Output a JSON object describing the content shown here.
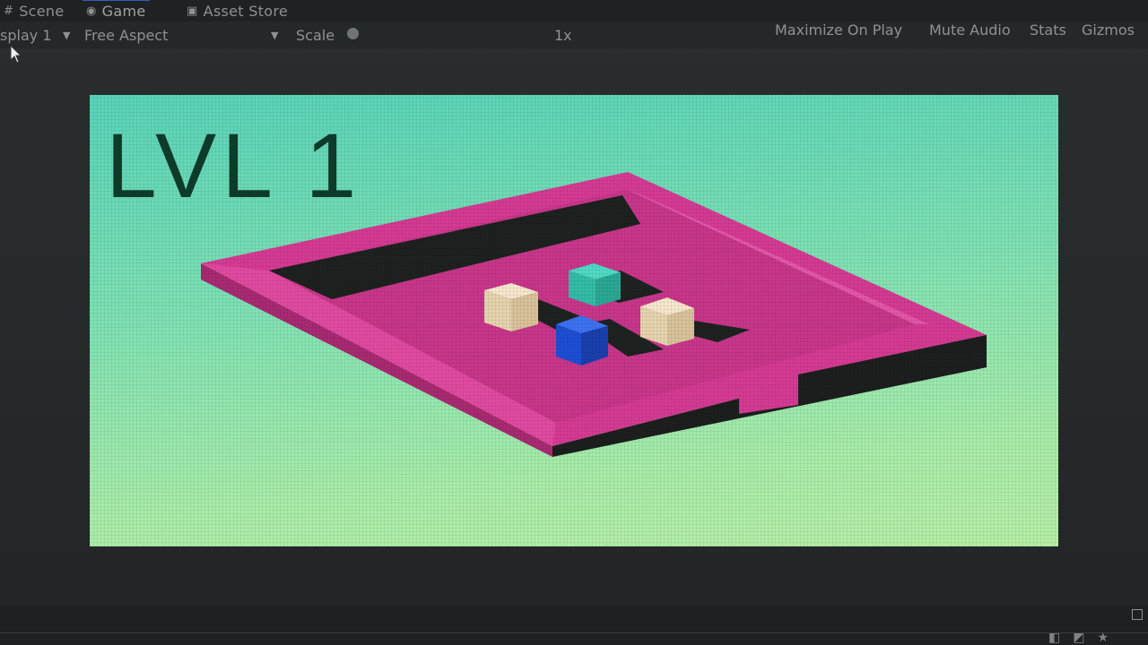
{
  "tabs": {
    "scene": "Scene",
    "game": "Game",
    "asset_store": "Asset Store"
  },
  "toolbar": {
    "display": "splay 1",
    "aspect": "Free Aspect",
    "scale_label": "Scale",
    "zoom": "1x",
    "maximize_on_play": "Maximize On Play",
    "mute_audio": "Mute Audio",
    "stats": "Stats",
    "gizmos": "Gizmos"
  },
  "game": {
    "level_title": "LVL 1"
  },
  "colors": {
    "sky_top": "#58d3b8",
    "sky_bottom": "#b5efa6",
    "board_magenta": "#d53a93",
    "board_dark": "#1c1f1d",
    "crate": "#eedcbc",
    "goal_cube": "#3ac7b2",
    "player_cube": "#1a4fd6",
    "title_text": "#0e3a2a"
  },
  "icons": {
    "scene_tab": "hash-icon",
    "game_tab": "gamepad-icon",
    "asset_store_tab": "store-bag-icon"
  }
}
